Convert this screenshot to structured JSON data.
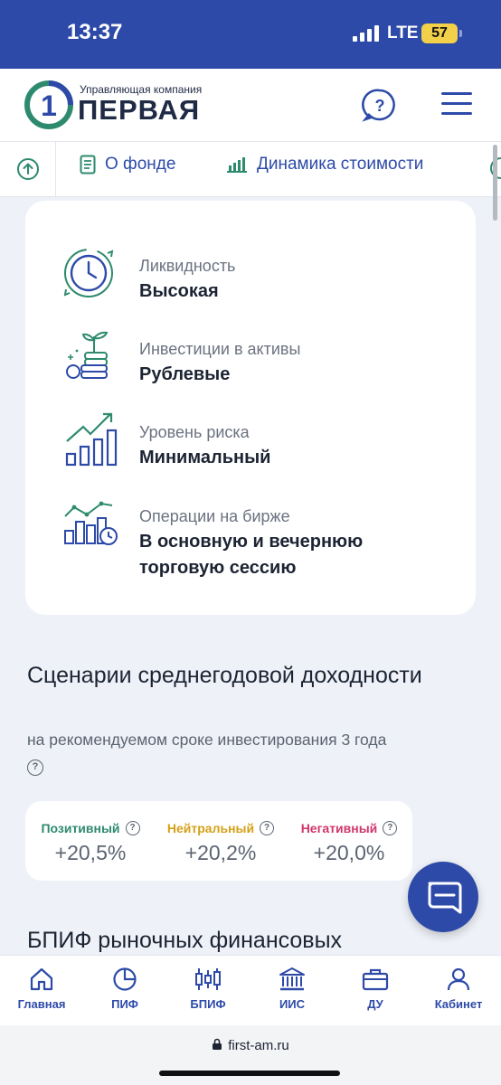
{
  "status_bar": {
    "time": "13:37",
    "network": "LTE",
    "battery": "57"
  },
  "header": {
    "logo_digit": "1",
    "logo_subtitle": "Управляющая компания",
    "logo_name": "ПЕРВАЯ"
  },
  "ghost_text": "О фонде",
  "tabs": [
    {
      "label": "О фонде",
      "icon": "document-icon"
    },
    {
      "label": "Динамика стоимости",
      "icon": "bar-chart-icon"
    }
  ],
  "features": [
    {
      "label": "Ликвидность",
      "value": "Высокая",
      "icon": "clock-icon"
    },
    {
      "label": "Инвестиции в активы",
      "value": "Рублевые",
      "icon": "plant-coins-icon"
    },
    {
      "label": "Уровень риска",
      "value": "Минимальный",
      "icon": "growth-chart-icon"
    },
    {
      "label": "Операции на бирже",
      "value": "В основную и вечернюю торговую сессию",
      "icon": "exchange-chart-icon"
    }
  ],
  "scenarios": {
    "title": "Сценарии среднегодовой доходности",
    "subtitle": "на рекомендуемом сроке инвестирования 3 года",
    "items": [
      {
        "label": "Позитивный",
        "value": "+20,5%",
        "color": "#2e8a6e"
      },
      {
        "label": "Нейтральный",
        "value": "+20,2%",
        "color": "#d4a017"
      },
      {
        "label": "Негативный",
        "value": "+20,0%",
        "color": "#d1356b"
      }
    ]
  },
  "next_section_title": "БПИФ рыночных финансовых",
  "bottom_nav": [
    {
      "label": "Главная",
      "icon": "home-icon"
    },
    {
      "label": "ПИФ",
      "icon": "pie-chart-icon"
    },
    {
      "label": "БПИФ",
      "icon": "candlestick-icon"
    },
    {
      "label": "ИИС",
      "icon": "bank-icon"
    },
    {
      "label": "ДУ",
      "icon": "briefcase-icon"
    },
    {
      "label": "Кабинет",
      "icon": "user-icon"
    }
  ],
  "browser": {
    "url": "first-am.ru"
  },
  "colors": {
    "brand": "#2d4aa8",
    "accent_teal": "#2e8a6e",
    "background": "#eef1f7"
  }
}
